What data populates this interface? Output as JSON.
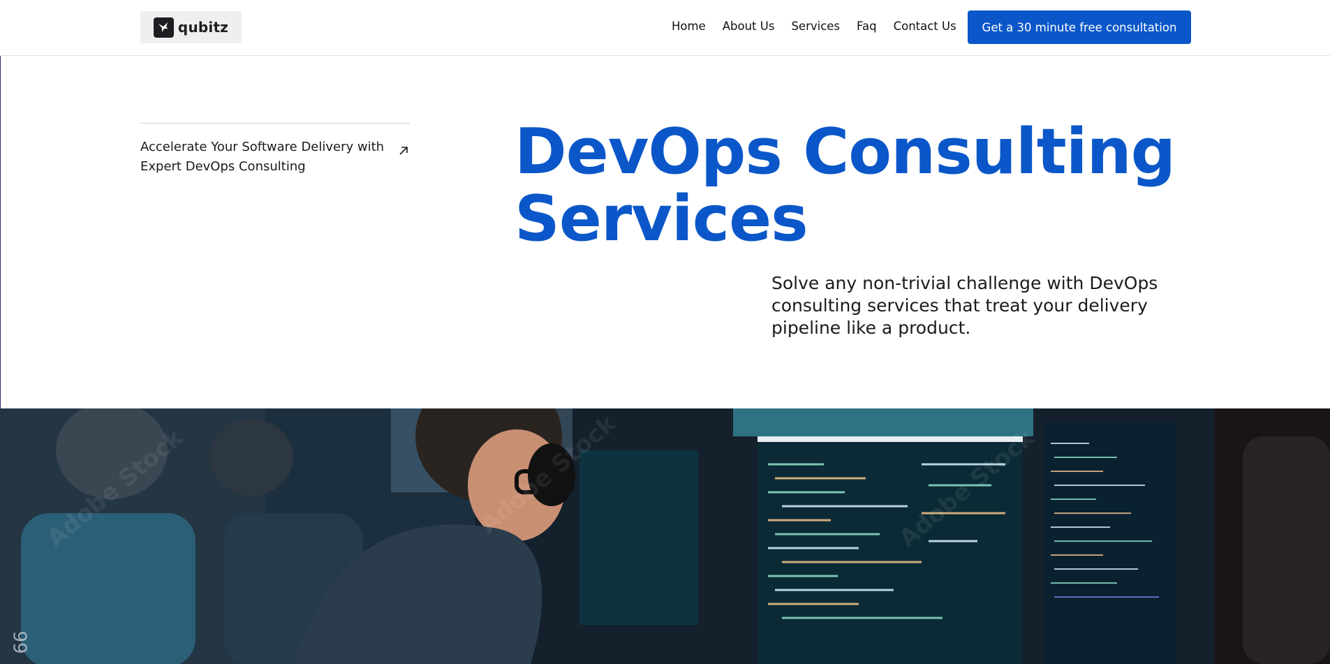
{
  "header": {
    "logo_text": "qubitz",
    "nav": [
      "Home",
      "About Us",
      "Services",
      "Faq",
      "Contact Us"
    ],
    "cta_label": "Get a 30 minute free consultation"
  },
  "hero": {
    "tagline": "Accelerate Your Software Delivery with Expert DevOps Consulting",
    "title_line1": "DevOps Consulting",
    "title_line2": "Services",
    "subtitle": "Solve any non-trivial challenge with DevOps consulting services that treat your delivery pipeline like a product."
  },
  "colors": {
    "brand_blue": "#0b57c9",
    "text_dark": "#1a1a1f"
  },
  "icons": {
    "logo": "bird-logo-icon",
    "tag": "arrow-up-right-icon"
  },
  "image": {
    "subject": "developers at computer monitors with code",
    "corner_text": "66"
  }
}
